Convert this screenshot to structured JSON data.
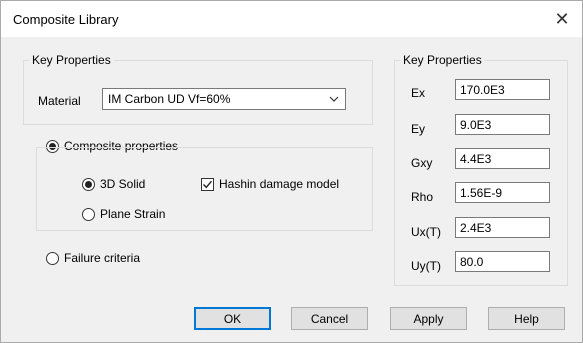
{
  "window": {
    "title": "Composite Library",
    "close_glyph": "✕"
  },
  "left_group": {
    "label": "Key Properties",
    "material_label": "Material",
    "material_value": "IM Carbon UD Vf=60%"
  },
  "composite": {
    "radio_label": "Composite properties",
    "selected": true,
    "solid_label": "3D Solid",
    "solid_selected": true,
    "plane_label": "Plane Strain",
    "plane_selected": false,
    "hashin_label": "Hashin damage model",
    "hashin_checked": true
  },
  "failure": {
    "radio_label": "Failure criteria",
    "selected": false
  },
  "right_group": {
    "label": "Key Properties",
    "props": [
      {
        "name": "Ex",
        "value": "170.0E3"
      },
      {
        "name": "Ey",
        "value": "9.0E3"
      },
      {
        "name": "Gxy",
        "value": "4.4E3"
      },
      {
        "name": "Rho",
        "value": "1.56E-9"
      },
      {
        "name": "Ux(T)",
        "value": "2.4E3"
      },
      {
        "name": "Uy(T)",
        "value": "80.0"
      }
    ]
  },
  "buttons": {
    "ok": "OK",
    "cancel": "Cancel",
    "apply": "Apply",
    "help": "Help"
  },
  "colors": {
    "accent": "#0078d7",
    "dialog_bg": "#f0f0f0",
    "titlebar_bg": "#ffffff"
  },
  "icons": {
    "close": "close-icon",
    "dropdown": "chevron-down-icon",
    "check": "checkmark-icon"
  }
}
